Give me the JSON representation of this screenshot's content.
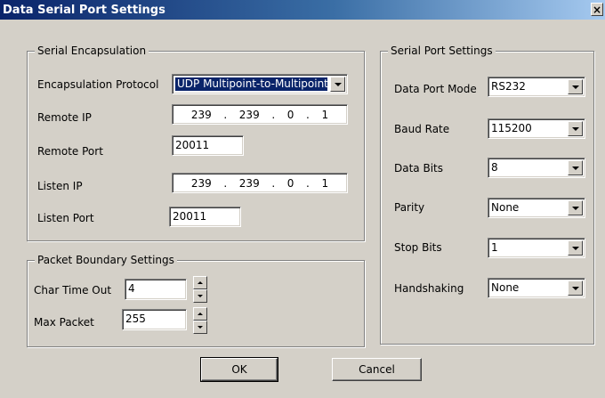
{
  "window": {
    "title": "Data Serial Port Settings",
    "close_glyph": "×"
  },
  "encap": {
    "legend": "Serial Encapsulation",
    "protocol_label": "Encapsulation Protocol",
    "protocol_value": "UDP Multipoint-to-Multipoint",
    "remote_ip_label": "Remote IP",
    "remote_ip": [
      "239",
      "239",
      "0",
      "1"
    ],
    "remote_port_label": "Remote Port",
    "remote_port": "20011",
    "listen_ip_label": "Listen IP",
    "listen_ip": [
      "239",
      "239",
      "0",
      "1"
    ],
    "listen_port_label": "Listen Port",
    "listen_port": "20011"
  },
  "packet": {
    "legend": "Packet Boundary Settings",
    "char_timeout_label": "Char Time Out",
    "char_timeout": "4",
    "max_packet_label": "Max Packet",
    "max_packet": "255"
  },
  "serial": {
    "legend": "Serial Port Settings",
    "mode_label": "Data Port Mode",
    "mode": "RS232",
    "baud_label": "Baud Rate",
    "baud": "115200",
    "bits_label": "Data Bits",
    "bits": "8",
    "parity_label": "Parity",
    "parity": "None",
    "stop_label": "Stop Bits",
    "stop": "1",
    "hand_label": "Handshaking",
    "hand": "None"
  },
  "buttons": {
    "ok": "OK",
    "cancel": "Cancel"
  },
  "icons": {
    "dropdown": "chevron-down-icon",
    "spin_up": "spin-up-icon",
    "spin_down": "spin-down-icon"
  }
}
